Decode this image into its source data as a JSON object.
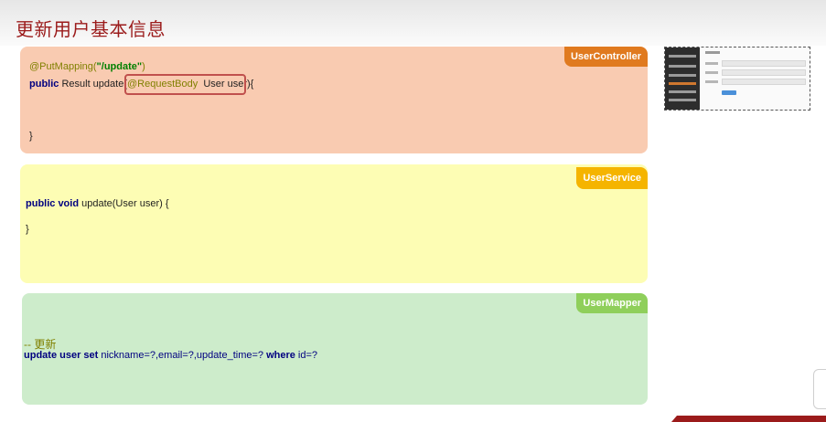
{
  "page": {
    "title": "更新用户基本信息"
  },
  "controller_panel": {
    "tag": "UserController",
    "line1_annotation": "@PutMapping(",
    "line1_string": "\"/update\"",
    "line1_close": ")",
    "line2_kw": "public",
    "line2_text": " Result update(",
    "line2_annotation": "@RequestBody",
    "line2_param": "  User user",
    "line2_end": "){",
    "line3": "}"
  },
  "service_panel": {
    "tag": "UserService",
    "line1_kw": "public void",
    "line1_text": " update(User user) {",
    "line2": "}"
  },
  "mapper_panel": {
    "tag": "UserMapper",
    "comment": "-- 更新",
    "sql_kw1": "update user set",
    "sql_text1": " nickname=?,email=?,update_time=? ",
    "sql_kw2": "where",
    "sql_text2": " id=?"
  },
  "colors": {
    "controller_bg": "#f9cbb1",
    "controller_tag": "#e07a1f",
    "service_bg": "#fdfdb4",
    "service_tag": "#f5b400",
    "mapper_bg": "#cdeccb",
    "mapper_tag": "#8fcf5b",
    "title": "#9b1b1b"
  }
}
